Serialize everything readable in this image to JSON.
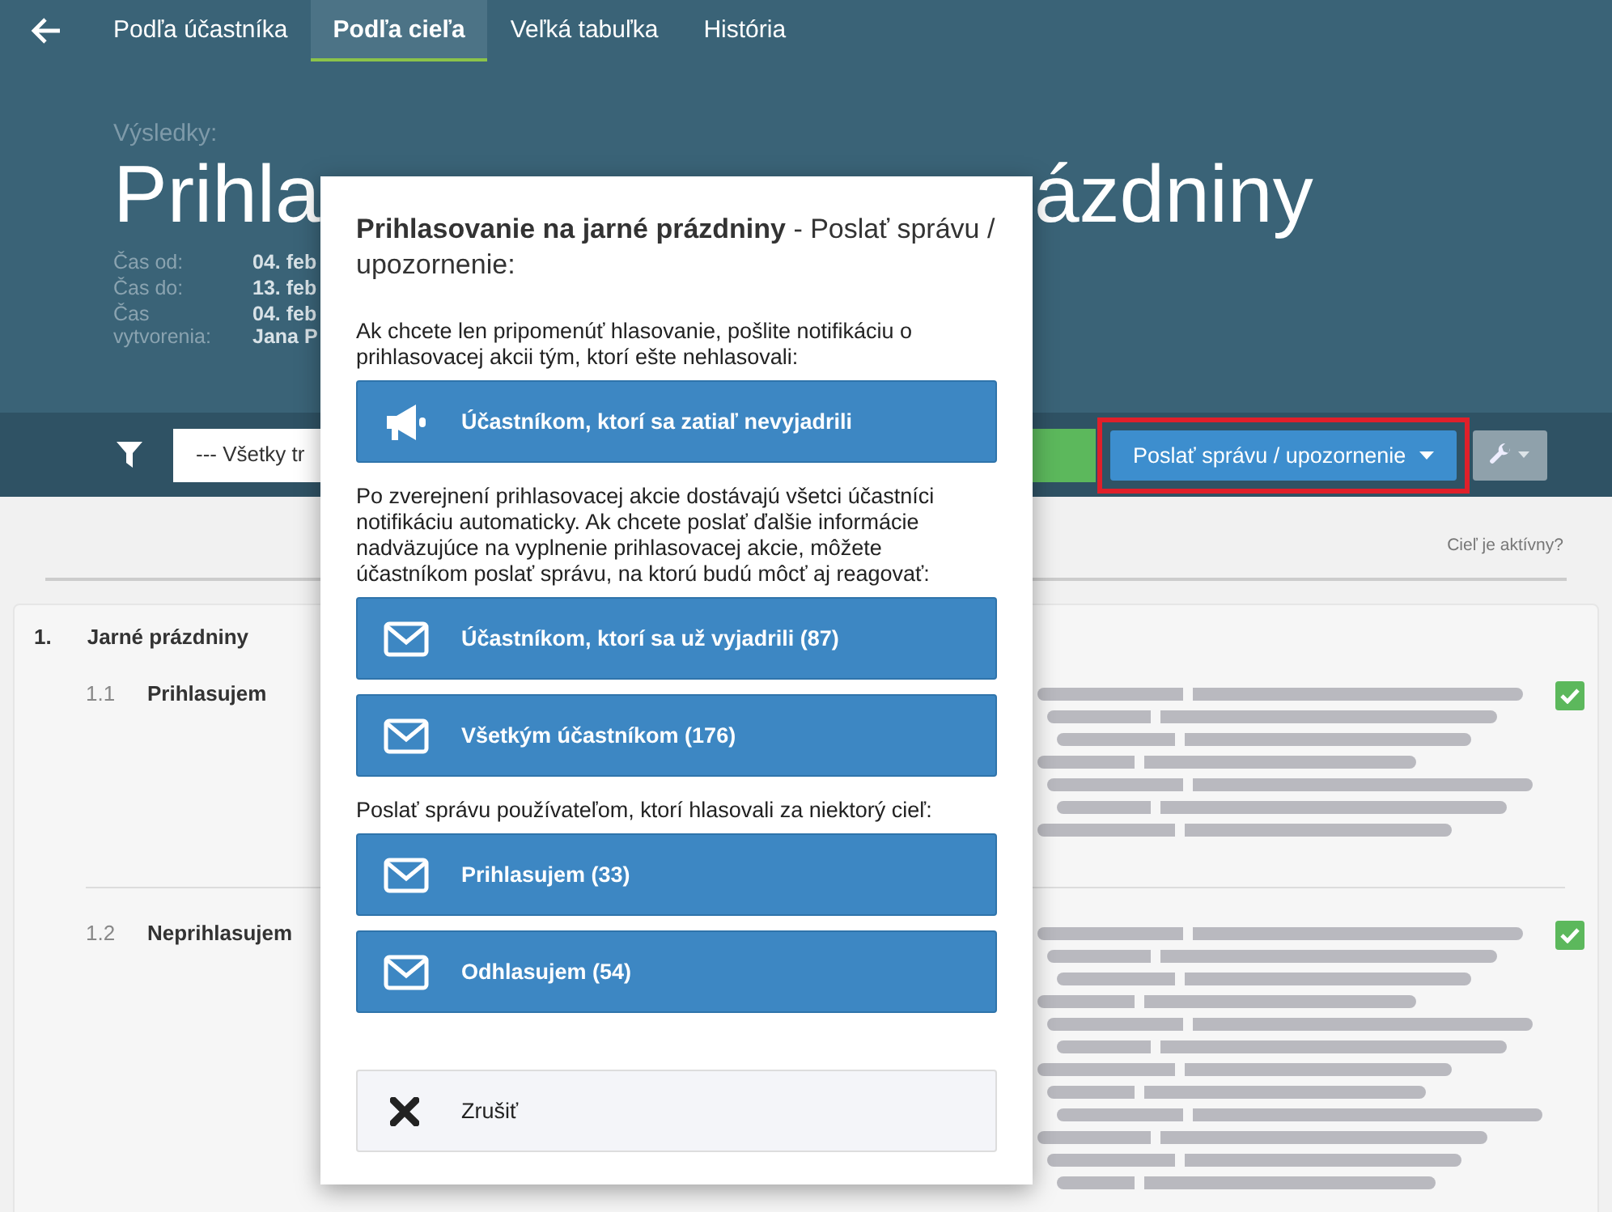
{
  "tabs": [
    {
      "label": "Podľa účastníka",
      "selected": false
    },
    {
      "label": "Podľa cieľa",
      "selected": true
    },
    {
      "label": "Veľká tabuľka",
      "selected": false
    },
    {
      "label": "História",
      "selected": false
    }
  ],
  "header": {
    "caption": "Výsledky:",
    "title_parts": [
      "Prihla",
      "ázdniny"
    ],
    "meta": [
      {
        "label": "Čas od:",
        "values": [
          "04. feb"
        ]
      },
      {
        "label": "Čas do:",
        "values": [
          "13. feb"
        ]
      },
      {
        "label": "Čas vytvorenia:",
        "values": [
          "04. feb",
          "Jana P"
        ]
      }
    ]
  },
  "toolbar": {
    "filter_select": "--- Všetky tr",
    "send_button": {
      "label": "Poslať správu / upozornenie",
      "highlighted": true
    }
  },
  "status_link": "Cieľ je aktívny?",
  "goal": {
    "number": "1.",
    "title": "Jarné prázdniny",
    "options": [
      {
        "number": "1.1",
        "label": "Prihlasujem",
        "checked": true
      },
      {
        "number": "1.2",
        "label": "Neprihlasujem",
        "checked": true
      }
    ]
  },
  "modal": {
    "title": "**Prihlasovanie na jarné prázdniny** - Poslať správu / upozornenie:",
    "items": [
      {
        "kind": "note",
        "text": "Ak chcete len pripomenúť hlasovanie, pošlite notifikáciu o prihlasovacej akcii tým, ktorí ešte nehlasovali:"
      },
      {
        "kind": "remind",
        "label": "Účastníkom, ktorí sa zatiaľ nevyjadrili"
      },
      {
        "kind": "note",
        "text": "Po zverejnení prihlasovacej akcie dostávajú všetci účastníci notifikáciu automaticky. Ak chcete poslať ďalšie informácie nadväzujúce na vyplnenie prihlasovacej akcie, môžete účastníkom poslať správu, na ktorú budú môcť aj reagovať:"
      },
      {
        "kind": "message",
        "label": "Účastníkom, ktorí sa už vyjadrili (87)"
      },
      {
        "kind": "message",
        "label": "Všetkým účastníkom (176)"
      },
      {
        "kind": "note",
        "text": "Poslať správu používateľom, ktorí hlasovali za niektorý cieľ:"
      },
      {
        "kind": "message",
        "label": "Prihlasujem (33)"
      },
      {
        "kind": "message",
        "label": "Odhlasujem (54)"
      }
    ],
    "cancel": "Zrušiť"
  }
}
